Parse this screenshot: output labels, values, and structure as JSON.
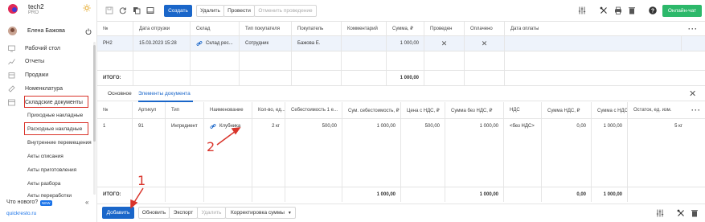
{
  "sidebar": {
    "app_name": "tech2",
    "plan": "PRO",
    "user_name": "Елена Бажова",
    "items": [
      {
        "label": "Рабочий стол",
        "icon": "desktop-icon"
      },
      {
        "label": "Отчеты",
        "icon": "reports-icon"
      },
      {
        "label": "Продажи",
        "icon": "sales-icon"
      },
      {
        "label": "Номенклатура",
        "icon": "nomenclature-icon"
      },
      {
        "label": "Складские документы",
        "icon": "warehouse-icon"
      }
    ],
    "sub_items": [
      "Приходные накладные",
      "Расходные накладные",
      "Внутренние перемещения",
      "Акты списания",
      "Акты приготовления",
      "Акты разбора",
      "Акты переработки"
    ],
    "whats_new": "Что нового?",
    "new_badge": "NEW",
    "domain": "quickresto.ru"
  },
  "toolbar": {
    "create": "Создать",
    "delete": "Удалить",
    "post": "Провести",
    "unpost": "Отменить проведение",
    "chat": "Онлайн-чат"
  },
  "main_table": {
    "headers": [
      "№",
      "Дата отгрузки",
      "Склад",
      "Тип покупателя",
      "Покупатель",
      "Комментарий",
      "Сумма, ₽",
      "Проведен",
      "Оплачено",
      "Дата оплаты"
    ],
    "rows": [
      [
        "РН2",
        "15.03.2023 15:28",
        "Склад рес...",
        "Сотрудник",
        "Бажова Е.",
        "",
        "1 000,00",
        "✕",
        "✕",
        ""
      ]
    ],
    "total_label": "ИТОГО:",
    "total_sum": "1 000,00"
  },
  "tabs": [
    "Основное",
    "Элементы документа"
  ],
  "items_table": {
    "headers": [
      "№",
      "Артикул",
      "Тип",
      "Наименование",
      "Кол-во, ед...",
      "Себестоимость 1 е...",
      "Сум. себестоимость, ₽",
      "Цена с НДС, ₽",
      "Сумма без НДС, ₽",
      "НДС",
      "Сумма НДС, ₽",
      "Сумма с НДС, ₽",
      "Остаток, ед. изм."
    ],
    "rows": [
      [
        "1",
        "91",
        "Ингредиент",
        "Клубника",
        "2 кг",
        "500,00",
        "1 000,00",
        "500,00",
        "1 000,00",
        "<без НДС>",
        "0,00",
        "1 000,00",
        "5 кг"
      ]
    ],
    "total_label": "ИТОГО:",
    "totals": {
      "sum_cost": "1 000,00",
      "sum_no_vat": "1 000,00",
      "vat_sum": "0,00",
      "sum_vat": "1 000,00"
    }
  },
  "bottom": {
    "add": "Добавить",
    "refresh": "Обновить",
    "export": "Экспорт",
    "delete": "Удалить",
    "correction": "Корректировка суммы"
  },
  "annotations": {
    "one": "1",
    "two": "2"
  },
  "colors": {
    "accent": "#1a66c9",
    "annotation": "#d9342b",
    "chat": "#2cb86a"
  }
}
